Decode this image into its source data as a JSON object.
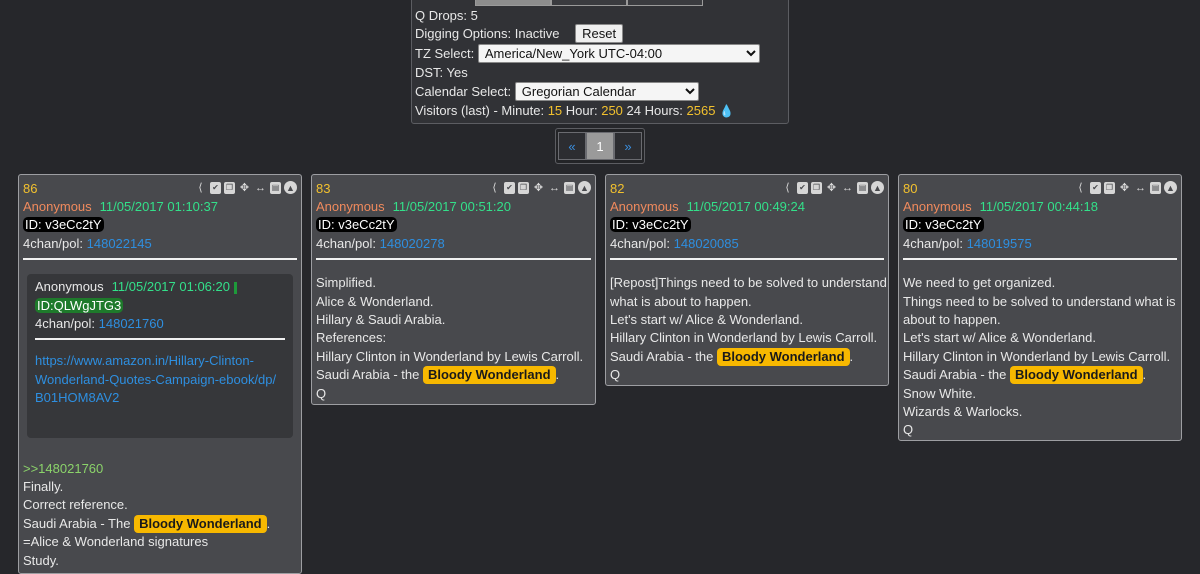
{
  "panel": {
    "q_drops": "Q Drops: 5",
    "digging": "Digging Options: Inactive",
    "reset_label": "Reset",
    "tz_label": "TZ Select:",
    "tz_value": "America/New_York UTC-04:00",
    "dst": "DST: Yes",
    "calendar_label": "Calendar Select:",
    "calendar_value": "Gregorian Calendar",
    "visitors_prefix": "Visitors (last) - Minute:",
    "visitors_minute": "15",
    "visitors_hour_label": "Hour:",
    "visitors_hour": "250",
    "visitors_24_label": "24 Hours:",
    "visitors_24": "2565",
    "accent_yellow": "#f2c12e",
    "drop_icon": "water-drop-icon"
  },
  "pager": {
    "prev": "«",
    "page": "1",
    "next": "»"
  },
  "toolbar_icons": [
    "share-icon",
    "check-icon",
    "copy-icon",
    "move-icon",
    "resize-icon",
    "clipboard-icon",
    "up-icon"
  ],
  "posts": [
    {
      "num": "86",
      "author": "Anonymous",
      "date": "11/05/2017 01:10:37",
      "id": "ID: v3eCc2tY",
      "board": "4chan/pol:",
      "post_id": "148022145",
      "ref": {
        "author": "Anonymous",
        "date": "11/05/2017 01:06:20",
        "id": "ID:QLWgJTG3",
        "board": "4chan/pol:",
        "post_id": "148021760",
        "url_lines": [
          "https://www.amazon.in/Hillary-Clinton-",
          "Wonderland-Quotes-Campaign-ebook/dp/",
          "B01HOM8AV2"
        ]
      },
      "quote_ref": ">>148021760",
      "lines": [
        "Finally.",
        "Correct reference.",
        "Saudi Arabia - The ",
        "=Alice & Wonderland signatures",
        "Study."
      ],
      "tag": "Bloody Wonderland"
    },
    {
      "num": "83",
      "author": "Anonymous",
      "date": "11/05/2017 00:51:20",
      "id": "ID: v3eCc2tY",
      "board": "4chan/pol:",
      "post_id": "148020278",
      "lines": [
        "Simplified.",
        "Alice & Wonderland.",
        "Hillary & Saudi Arabia.",
        "References:",
        "Hillary Clinton in Wonderland by Lewis Carroll.",
        "Saudi Arabia - the ",
        "Q"
      ],
      "tag": "Bloody Wonderland"
    },
    {
      "num": "82",
      "author": "Anonymous",
      "date": "11/05/2017 00:49:24",
      "id": "ID: v3eCc2tY",
      "board": "4chan/pol:",
      "post_id": "148020085",
      "lines": [
        "[Repost]Things need to be solved to understand",
        "what is about to happen.",
        "Let's start w/ Alice & Wonderland.",
        "Hillary Clinton in Wonderland by Lewis Carroll.",
        "Saudi Arabia - the ",
        "Q"
      ],
      "tag": "Bloody Wonderland"
    },
    {
      "num": "80",
      "author": "Anonymous",
      "date": "11/05/2017 00:44:18",
      "id": "ID: v3eCc2tY",
      "board": "4chan/pol:",
      "post_id": "148019575",
      "lines": [
        "We need to get organized.",
        "Things need to be solved to understand what is",
        "about to happen.",
        "Let's start w/ Alice & Wonderland.",
        "Hillary Clinton in Wonderland by Lewis Carroll.",
        "Saudi Arabia - the ",
        "Snow White.",
        "Wizards & Warlocks.",
        "Q"
      ],
      "tag": "Bloody Wonderland"
    }
  ]
}
